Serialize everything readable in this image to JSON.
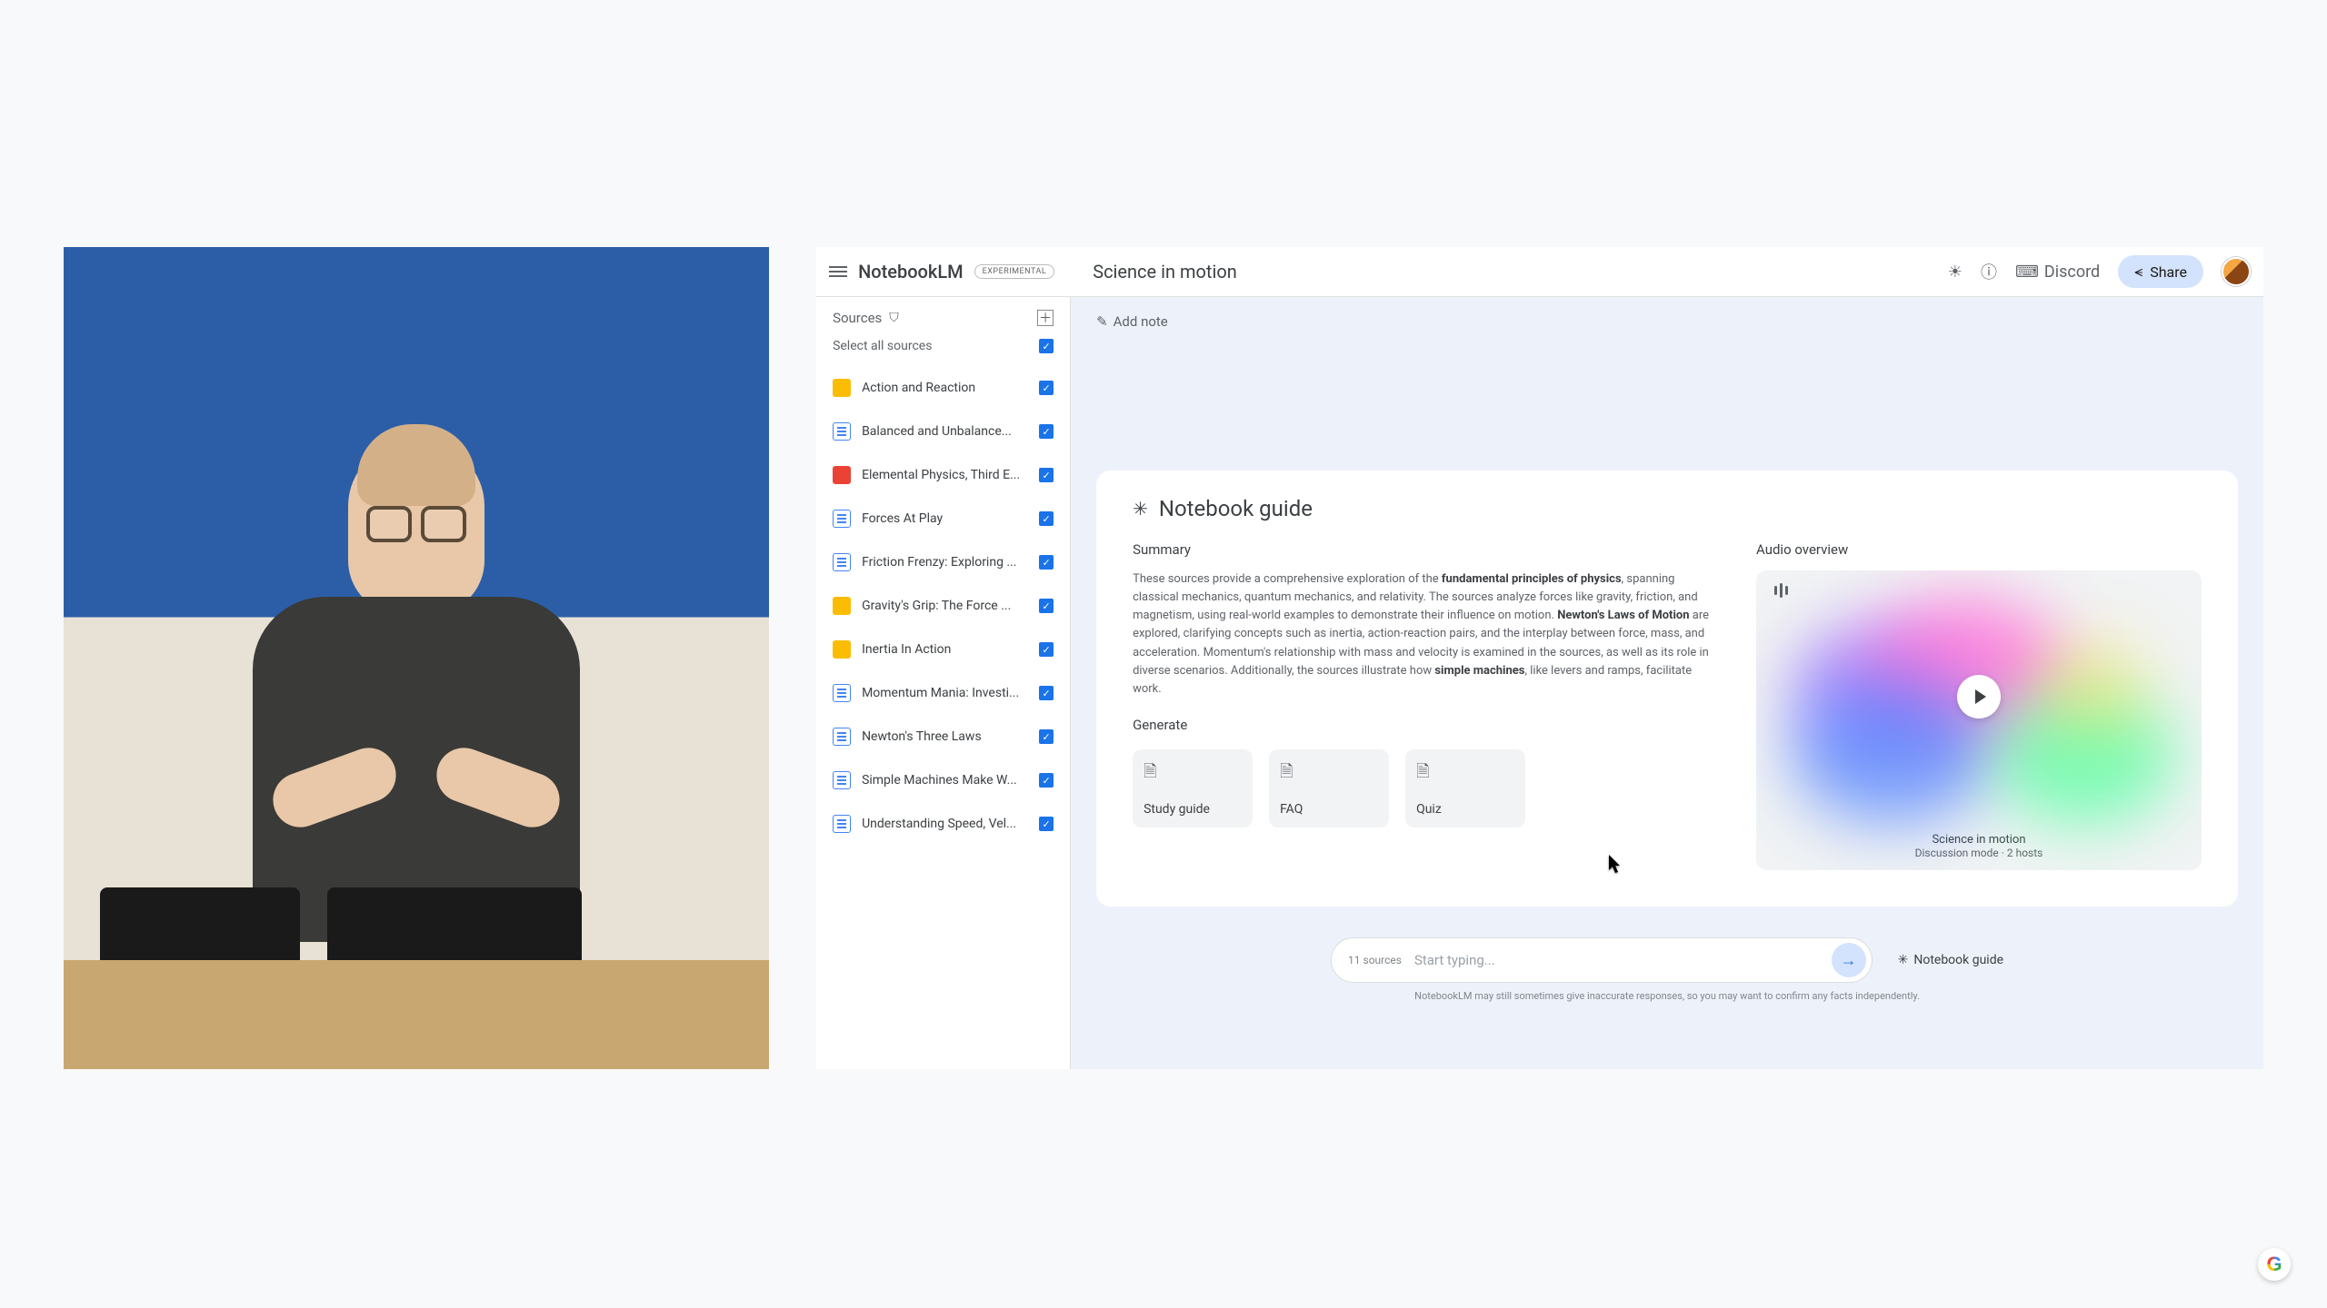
{
  "app": {
    "brand": "NotebookLM",
    "experimental_badge": "EXPERIMENTAL",
    "page_title": "Science in motion"
  },
  "header": {
    "discord_label": "Discord",
    "share_label": "Share"
  },
  "sources": {
    "title": "Sources",
    "select_all_label": "Select all sources",
    "items": [
      {
        "label": "Action and Reaction",
        "icon": "yellow"
      },
      {
        "label": "Balanced and Unbalance...",
        "icon": "blue"
      },
      {
        "label": "Elemental Physics, Third E...",
        "icon": "red"
      },
      {
        "label": "Forces At Play",
        "icon": "blue"
      },
      {
        "label": "Friction Frenzy: Exploring ...",
        "icon": "blue"
      },
      {
        "label": "Gravity's Grip: The Force ...",
        "icon": "yellow"
      },
      {
        "label": "Inertia In Action",
        "icon": "yellow"
      },
      {
        "label": "Momentum Mania: Investi...",
        "icon": "blue"
      },
      {
        "label": "Newton's Three Laws",
        "icon": "blue"
      },
      {
        "label": "Simple Machines Make W...",
        "icon": "blue"
      },
      {
        "label": "Understanding Speed, Vel...",
        "icon": "blue"
      }
    ]
  },
  "main": {
    "add_note_label": "Add note",
    "guide": {
      "title": "Notebook guide",
      "summary_label": "Summary",
      "summary": {
        "p1": "These sources provide a comprehensive exploration of the ",
        "b1": "fundamental principles of physics",
        "p2": ", spanning classical mechanics, quantum mechanics, and relativity. The sources analyze forces like gravity, friction, and magnetism, using real-world examples to demonstrate their influence on motion. ",
        "b2": "Newton's Laws of Motion",
        "p3": " are explored, clarifying concepts such as inertia, action-reaction pairs, and the interplay between force, mass, and acceleration. Momentum's relationship with mass and velocity is examined in the sources, as well as its role in diverse scenarios. Additionally, the sources illustrate how ",
        "b3": "simple machines",
        "p4": ", like levers and ramps, facilitate work."
      },
      "generate_label": "Generate",
      "generate": [
        {
          "label": "Study guide"
        },
        {
          "label": "FAQ"
        },
        {
          "label": "Quiz"
        }
      ],
      "audio_label": "Audio overview",
      "audio": {
        "title": "Science in motion",
        "subtitle": "Discussion mode · 2 hosts"
      }
    },
    "input": {
      "source_count": "11 sources",
      "placeholder": "Start typing...",
      "guide_link": "Notebook guide"
    },
    "disclaimer": "NotebookLM may still sometimes give inaccurate responses, so you may want to confirm any facts independently."
  }
}
